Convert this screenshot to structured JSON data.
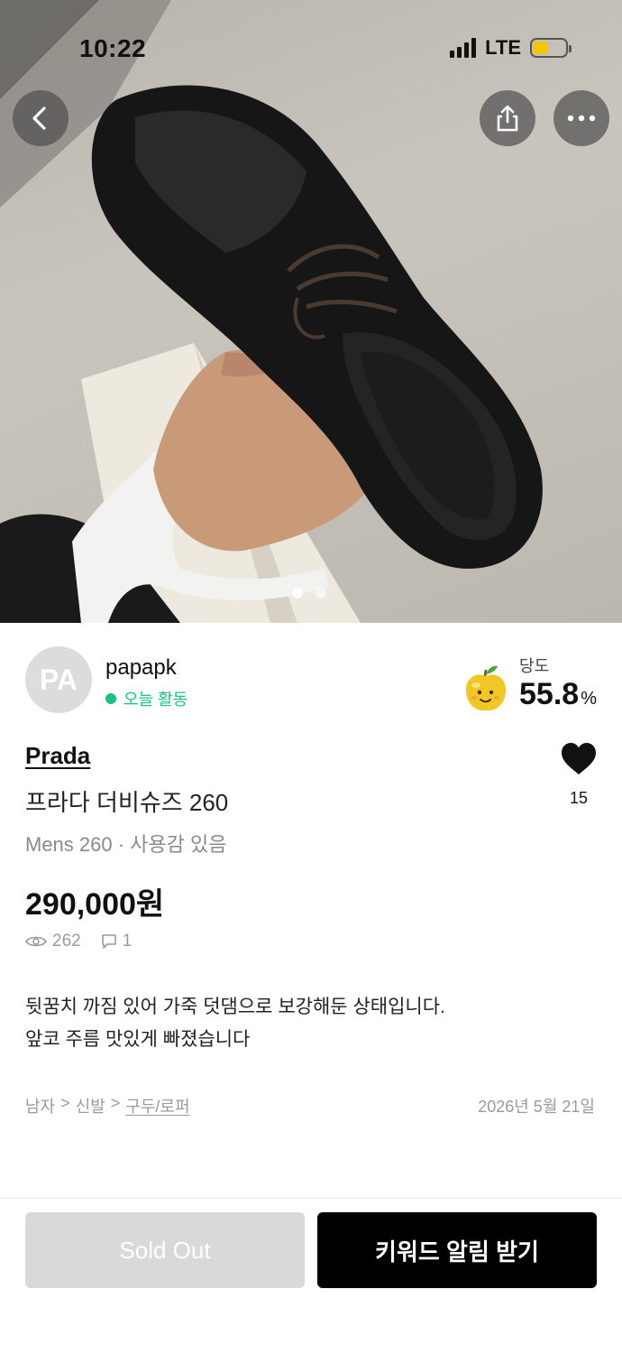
{
  "status_bar": {
    "time": "10:22",
    "network": "LTE"
  },
  "seller": {
    "avatar_initials": "PA",
    "name": "papapk",
    "activity": "오늘 활동",
    "sweetness_label": "당도",
    "sweetness_value": "55.8",
    "sweetness_unit": "%"
  },
  "product": {
    "brand": "Prada",
    "title": "프라다 더비슈즈 260",
    "meta": "Mens 260 · 사용감 있음",
    "price": "290,000원",
    "views": "262",
    "chats": "1",
    "likes": "15",
    "description": [
      "뒷꿈치 까짐 있어 가죽 덧댐으로 보강해둔 상태입니다.",
      "앞코 주름 맛있게 빠졌습니다"
    ],
    "category": {
      "level1": "남자",
      "sep": ">",
      "level2": "신발",
      "level3": "구두/로퍼"
    },
    "date": "2026년 5월 21일"
  },
  "images": {
    "count": 2,
    "active_index": 0
  },
  "buttons": {
    "sold_out": "Sold Out",
    "keyword_alert": "키워드 알림 받기"
  },
  "colors": {
    "accent_green": "#19c37d",
    "primary_button": "#000000",
    "disabled_button": "#d9d9d9"
  }
}
